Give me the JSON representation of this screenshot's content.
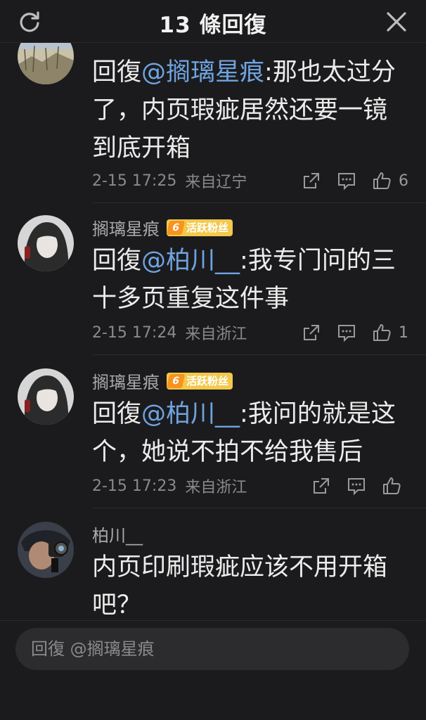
{
  "header": {
    "title": "13 條回復"
  },
  "comments": [
    {
      "text_prefix": "回復",
      "mention": "@搁璃星痕",
      "text_rest": ":那也太过分了，内页瑕疵居然还要一镜到底开箱",
      "time": "2-15 17:25",
      "location": "来自辽宁",
      "likes": "6"
    },
    {
      "username": "搁璃星痕",
      "badge_level": "6",
      "badge_label": "活跃粉丝",
      "text_prefix": "回復",
      "mention": "@柏川__",
      "text_rest": ":我专门问的三十多页重复这件事",
      "time": "2-15 17:24",
      "location": "来自浙江",
      "likes": "1"
    },
    {
      "username": "搁璃星痕",
      "badge_level": "6",
      "badge_label": "活跃粉丝",
      "text_prefix": "回復",
      "mention": "@柏川__",
      "text_rest": ":我问的就是这个，她说不拍不给我售后",
      "time": "2-15 17:23",
      "location": "来自浙江",
      "likes": ""
    },
    {
      "username": "柏川__",
      "text": "内页印刷瑕疵应该不用开箱吧？"
    }
  ],
  "reply_input": {
    "placeholder": "回復 @搁璃星痕"
  },
  "colors": {
    "background": "#1b1b1d",
    "mention": "#6fa3e0",
    "badge": "#f2c94c"
  }
}
